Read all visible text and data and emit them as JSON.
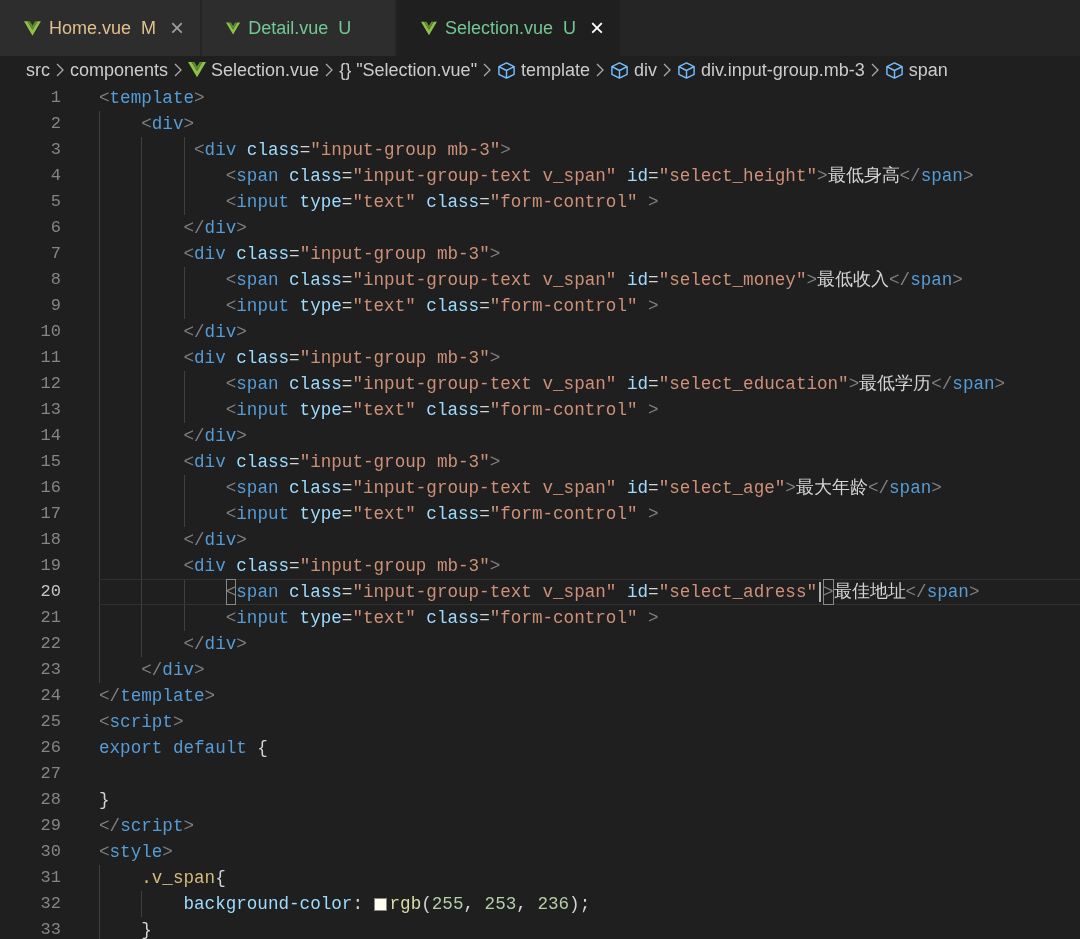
{
  "tabs": [
    {
      "label": "Home.vue",
      "badge": "M",
      "kind": "modified",
      "selected": false,
      "closable": true,
      "close": "×"
    },
    {
      "label": "Detail.vue",
      "badge": "U",
      "kind": "untracked",
      "selected": false,
      "closable": false
    },
    {
      "label": "Selection.vue",
      "badge": "U",
      "kind": "untracked",
      "selected": true,
      "closable": true,
      "close": "×"
    }
  ],
  "breadcrumbs": [
    {
      "kind": "folder",
      "label": "src"
    },
    {
      "kind": "folder",
      "label": "components"
    },
    {
      "kind": "file",
      "label": "Selection.vue"
    },
    {
      "kind": "module",
      "glyph": "{}",
      "label": "\"Selection.vue\""
    },
    {
      "kind": "element",
      "label": "template"
    },
    {
      "kind": "element",
      "label": "div"
    },
    {
      "kind": "element",
      "label": "div.input-group.mb-3"
    },
    {
      "kind": "element",
      "label": "span"
    }
  ],
  "editor": {
    "lines": [
      {
        "number": "1",
        "current": false,
        "tokens": [
          {
            "kind": "punct",
            "text": "<"
          },
          {
            "kind": "tag",
            "text": "template"
          },
          {
            "kind": "punct",
            "text": ">"
          }
        ]
      },
      {
        "number": "2",
        "current": false,
        "tokens": [
          {
            "kind": "punct",
            "text": "    <"
          },
          {
            "kind": "tag",
            "text": "div"
          },
          {
            "kind": "punct",
            "text": ">"
          }
        ]
      },
      {
        "number": "3",
        "current": false,
        "tokens": [
          {
            "kind": "punct",
            "text": "         <"
          },
          {
            "kind": "tag",
            "text": "div"
          },
          {
            "kind": "attr",
            "text": " class"
          },
          {
            "kind": "plain",
            "text": "="
          },
          {
            "kind": "string",
            "text": "\"input-group mb-3\""
          },
          {
            "kind": "punct",
            "text": ">"
          }
        ]
      },
      {
        "number": "4",
        "current": false,
        "tokens": [
          {
            "kind": "punct",
            "text": "            <"
          },
          {
            "kind": "tag",
            "text": "span"
          },
          {
            "kind": "attr",
            "text": " class"
          },
          {
            "kind": "plain",
            "text": "="
          },
          {
            "kind": "string",
            "text": "\"input-group-text v_span\""
          },
          {
            "kind": "attr",
            "text": " id"
          },
          {
            "kind": "plain",
            "text": "="
          },
          {
            "kind": "string",
            "text": "\"select_height\""
          },
          {
            "kind": "punct",
            "text": ">"
          },
          {
            "kind": "plain",
            "text": "最低身高"
          },
          {
            "kind": "punct",
            "text": "</"
          },
          {
            "kind": "tag",
            "text": "span"
          },
          {
            "kind": "punct",
            "text": ">"
          }
        ]
      },
      {
        "number": "5",
        "current": false,
        "tokens": [
          {
            "kind": "punct",
            "text": "            <"
          },
          {
            "kind": "tag",
            "text": "input"
          },
          {
            "kind": "attr",
            "text": " type"
          },
          {
            "kind": "plain",
            "text": "="
          },
          {
            "kind": "string",
            "text": "\"text\""
          },
          {
            "kind": "attr",
            "text": " class"
          },
          {
            "kind": "plain",
            "text": "="
          },
          {
            "kind": "string",
            "text": "\"form-control\""
          },
          {
            "kind": "punct",
            "text": " >"
          }
        ]
      },
      {
        "number": "6",
        "current": false,
        "tokens": [
          {
            "kind": "punct",
            "text": "        </"
          },
          {
            "kind": "tag",
            "text": "div"
          },
          {
            "kind": "punct",
            "text": ">"
          }
        ]
      },
      {
        "number": "7",
        "current": false,
        "tokens": [
          {
            "kind": "punct",
            "text": "        <"
          },
          {
            "kind": "tag",
            "text": "div"
          },
          {
            "kind": "attr",
            "text": " class"
          },
          {
            "kind": "plain",
            "text": "="
          },
          {
            "kind": "string",
            "text": "\"input-group mb-3\""
          },
          {
            "kind": "punct",
            "text": ">"
          }
        ]
      },
      {
        "number": "8",
        "current": false,
        "tokens": [
          {
            "kind": "punct",
            "text": "            <"
          },
          {
            "kind": "tag",
            "text": "span"
          },
          {
            "kind": "attr",
            "text": " class"
          },
          {
            "kind": "plain",
            "text": "="
          },
          {
            "kind": "string",
            "text": "\"input-group-text v_span\""
          },
          {
            "kind": "attr",
            "text": " id"
          },
          {
            "kind": "plain",
            "text": "="
          },
          {
            "kind": "string",
            "text": "\"select_money\""
          },
          {
            "kind": "punct",
            "text": ">"
          },
          {
            "kind": "plain",
            "text": "最低收入"
          },
          {
            "kind": "punct",
            "text": "</"
          },
          {
            "kind": "tag",
            "text": "span"
          },
          {
            "kind": "punct",
            "text": ">"
          }
        ]
      },
      {
        "number": "9",
        "current": false,
        "tokens": [
          {
            "kind": "punct",
            "text": "            <"
          },
          {
            "kind": "tag",
            "text": "input"
          },
          {
            "kind": "attr",
            "text": " type"
          },
          {
            "kind": "plain",
            "text": "="
          },
          {
            "kind": "string",
            "text": "\"text\""
          },
          {
            "kind": "attr",
            "text": " class"
          },
          {
            "kind": "plain",
            "text": "="
          },
          {
            "kind": "string",
            "text": "\"form-control\""
          },
          {
            "kind": "punct",
            "text": " >"
          }
        ]
      },
      {
        "number": "10",
        "current": false,
        "tokens": [
          {
            "kind": "punct",
            "text": "        </"
          },
          {
            "kind": "tag",
            "text": "div"
          },
          {
            "kind": "punct",
            "text": ">"
          }
        ]
      },
      {
        "number": "11",
        "current": false,
        "tokens": [
          {
            "kind": "punct",
            "text": "        <"
          },
          {
            "kind": "tag",
            "text": "div"
          },
          {
            "kind": "attr",
            "text": " class"
          },
          {
            "kind": "plain",
            "text": "="
          },
          {
            "kind": "string",
            "text": "\"input-group mb-3\""
          },
          {
            "kind": "punct",
            "text": ">"
          }
        ]
      },
      {
        "number": "12",
        "current": false,
        "tokens": [
          {
            "kind": "punct",
            "text": "            <"
          },
          {
            "kind": "tag",
            "text": "span"
          },
          {
            "kind": "attr",
            "text": " class"
          },
          {
            "kind": "plain",
            "text": "="
          },
          {
            "kind": "string",
            "text": "\"input-group-text v_span\""
          },
          {
            "kind": "attr",
            "text": " id"
          },
          {
            "kind": "plain",
            "text": "="
          },
          {
            "kind": "string",
            "text": "\"select_education\""
          },
          {
            "kind": "punct",
            "text": ">"
          },
          {
            "kind": "plain",
            "text": "最低学历"
          },
          {
            "kind": "punct",
            "text": "</"
          },
          {
            "kind": "tag",
            "text": "span"
          },
          {
            "kind": "punct",
            "text": ">"
          }
        ]
      },
      {
        "number": "13",
        "current": false,
        "tokens": [
          {
            "kind": "punct",
            "text": "            <"
          },
          {
            "kind": "tag",
            "text": "input"
          },
          {
            "kind": "attr",
            "text": " type"
          },
          {
            "kind": "plain",
            "text": "="
          },
          {
            "kind": "string",
            "text": "\"text\""
          },
          {
            "kind": "attr",
            "text": " class"
          },
          {
            "kind": "plain",
            "text": "="
          },
          {
            "kind": "string",
            "text": "\"form-control\""
          },
          {
            "kind": "punct",
            "text": " >"
          }
        ]
      },
      {
        "number": "14",
        "current": false,
        "tokens": [
          {
            "kind": "punct",
            "text": "        </"
          },
          {
            "kind": "tag",
            "text": "div"
          },
          {
            "kind": "punct",
            "text": ">"
          }
        ]
      },
      {
        "number": "15",
        "current": false,
        "tokens": [
          {
            "kind": "punct",
            "text": "        <"
          },
          {
            "kind": "tag",
            "text": "div"
          },
          {
            "kind": "attr",
            "text": " class"
          },
          {
            "kind": "plain",
            "text": "="
          },
          {
            "kind": "string",
            "text": "\"input-group mb-3\""
          },
          {
            "kind": "punct",
            "text": ">"
          }
        ]
      },
      {
        "number": "16",
        "current": false,
        "tokens": [
          {
            "kind": "punct",
            "text": "            <"
          },
          {
            "kind": "tag",
            "text": "span"
          },
          {
            "kind": "attr",
            "text": " class"
          },
          {
            "kind": "plain",
            "text": "="
          },
          {
            "kind": "string",
            "text": "\"input-group-text v_span\""
          },
          {
            "kind": "attr",
            "text": " id"
          },
          {
            "kind": "plain",
            "text": "="
          },
          {
            "kind": "string",
            "text": "\"select_age\""
          },
          {
            "kind": "punct",
            "text": ">"
          },
          {
            "kind": "plain",
            "text": "最大年龄"
          },
          {
            "kind": "punct",
            "text": "</"
          },
          {
            "kind": "tag",
            "text": "span"
          },
          {
            "kind": "punct",
            "text": ">"
          }
        ]
      },
      {
        "number": "17",
        "current": false,
        "tokens": [
          {
            "kind": "punct",
            "text": "            <"
          },
          {
            "kind": "tag",
            "text": "input"
          },
          {
            "kind": "attr",
            "text": " type"
          },
          {
            "kind": "plain",
            "text": "="
          },
          {
            "kind": "string",
            "text": "\"text\""
          },
          {
            "kind": "attr",
            "text": " class"
          },
          {
            "kind": "plain",
            "text": "="
          },
          {
            "kind": "string",
            "text": "\"form-control\""
          },
          {
            "kind": "punct",
            "text": " >"
          }
        ]
      },
      {
        "number": "18",
        "current": false,
        "tokens": [
          {
            "kind": "punct",
            "text": "        </"
          },
          {
            "kind": "tag",
            "text": "div"
          },
          {
            "kind": "punct",
            "text": ">"
          }
        ]
      },
      {
        "number": "19",
        "current": false,
        "tokens": [
          {
            "kind": "punct",
            "text": "        <"
          },
          {
            "kind": "tag",
            "text": "div"
          },
          {
            "kind": "attr",
            "text": " class"
          },
          {
            "kind": "plain",
            "text": "="
          },
          {
            "kind": "string",
            "text": "\"input-group mb-3\""
          },
          {
            "kind": "punct",
            "text": ">"
          }
        ]
      },
      {
        "number": "20",
        "current": true,
        "tokens": [
          {
            "kind": "bracket",
            "text": "            <"
          },
          {
            "kind": "tag",
            "text": "span"
          },
          {
            "kind": "attr",
            "text": " class"
          },
          {
            "kind": "plain",
            "text": "="
          },
          {
            "kind": "string",
            "text": "\"input-group-text v_span\""
          },
          {
            "kind": "attr",
            "text": " id"
          },
          {
            "kind": "plain",
            "text": "="
          },
          {
            "kind": "string",
            "text": "\"select_adress\""
          },
          {
            "kind": "cursor"
          },
          {
            "kind": "bracket",
            "text": ">"
          },
          {
            "kind": "plain",
            "text": "最佳地址"
          },
          {
            "kind": "punct",
            "text": "</"
          },
          {
            "kind": "tag",
            "text": "span"
          },
          {
            "kind": "punct",
            "text": ">"
          }
        ]
      },
      {
        "number": "21",
        "current": false,
        "tokens": [
          {
            "kind": "punct",
            "text": "            <"
          },
          {
            "kind": "tag",
            "text": "input"
          },
          {
            "kind": "attr",
            "text": " type"
          },
          {
            "kind": "plain",
            "text": "="
          },
          {
            "kind": "string",
            "text": "\"text\""
          },
          {
            "kind": "attr",
            "text": " class"
          },
          {
            "kind": "plain",
            "text": "="
          },
          {
            "kind": "string",
            "text": "\"form-control\""
          },
          {
            "kind": "punct",
            "text": " >"
          }
        ]
      },
      {
        "number": "22",
        "current": false,
        "tokens": [
          {
            "kind": "punct",
            "text": "        </"
          },
          {
            "kind": "tag",
            "text": "div"
          },
          {
            "kind": "punct",
            "text": ">"
          }
        ]
      },
      {
        "number": "23",
        "current": false,
        "tokens": [
          {
            "kind": "punct",
            "text": "    </"
          },
          {
            "kind": "tag",
            "text": "div"
          },
          {
            "kind": "punct",
            "text": ">"
          }
        ]
      },
      {
        "number": "24",
        "current": false,
        "tokens": [
          {
            "kind": "punct",
            "text": "</"
          },
          {
            "kind": "tag",
            "text": "template"
          },
          {
            "kind": "punct",
            "text": ">"
          }
        ]
      },
      {
        "number": "25",
        "current": false,
        "tokens": [
          {
            "kind": "punct",
            "text": "<"
          },
          {
            "kind": "tag",
            "text": "script"
          },
          {
            "kind": "punct",
            "text": ">"
          }
        ]
      },
      {
        "number": "26",
        "current": false,
        "tokens": [
          {
            "kind": "keyword",
            "text": "export default"
          },
          {
            "kind": "plain",
            "text": " {"
          }
        ]
      },
      {
        "number": "27",
        "current": false
      },
      {
        "number": "28",
        "current": false,
        "tokens": [
          {
            "kind": "plain",
            "text": "}"
          }
        ]
      },
      {
        "number": "29",
        "current": false,
        "tokens": [
          {
            "kind": "punct",
            "text": "</"
          },
          {
            "kind": "tag",
            "text": "script"
          },
          {
            "kind": "punct",
            "text": ">"
          }
        ]
      },
      {
        "number": "30",
        "current": false,
        "tokens": [
          {
            "kind": "punct",
            "text": "<"
          },
          {
            "kind": "tag",
            "text": "style"
          },
          {
            "kind": "punct",
            "text": ">"
          }
        ]
      },
      {
        "number": "31",
        "current": false,
        "tokens": [
          {
            "kind": "selector",
            "text": "    .v_span"
          },
          {
            "kind": "plain",
            "text": "{"
          }
        ]
      },
      {
        "number": "32",
        "current": false,
        "tokens": [
          {
            "kind": "attr",
            "text": "        background-color"
          },
          {
            "kind": "plain",
            "text": ": "
          },
          {
            "kind": "swatch",
            "color": "#fffdec"
          },
          {
            "kind": "function",
            "text": "rgb"
          },
          {
            "kind": "plain",
            "text": "("
          },
          {
            "kind": "number",
            "text": "255"
          },
          {
            "kind": "plain",
            "text": ", "
          },
          {
            "kind": "number",
            "text": "253"
          },
          {
            "kind": "plain",
            "text": ", "
          },
          {
            "kind": "number",
            "text": "236"
          },
          {
            "kind": "plain",
            "text": ");"
          }
        ]
      },
      {
        "number": "33",
        "current": false,
        "tokens": [
          {
            "kind": "plain",
            "text": "    }"
          }
        ]
      }
    ]
  }
}
